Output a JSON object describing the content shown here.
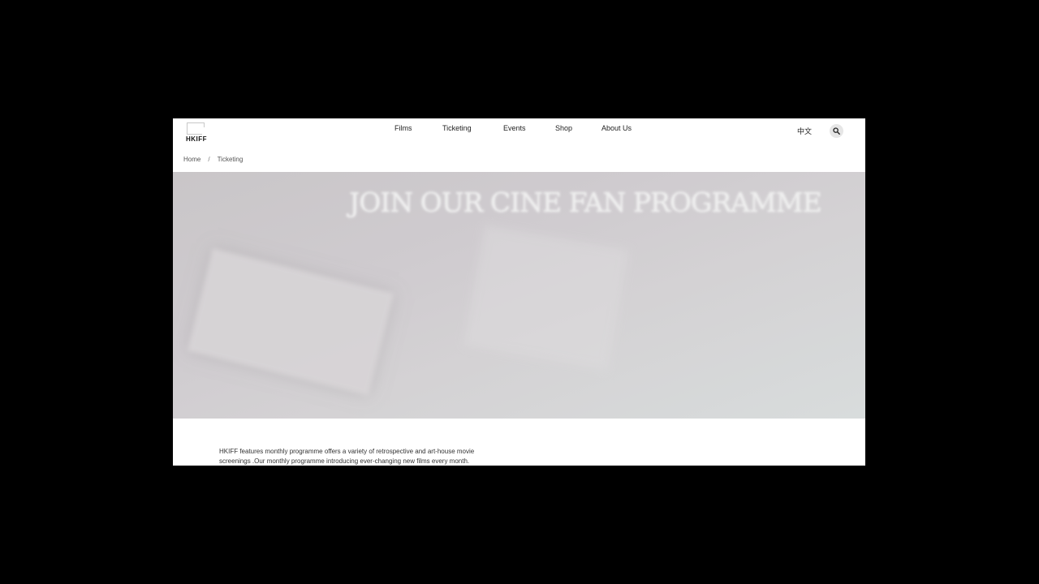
{
  "header": {
    "logo_text": "HKIFF",
    "nav": [
      {
        "label": "Films"
      },
      {
        "label": "Ticketing"
      },
      {
        "label": "Events"
      },
      {
        "label": "Shop"
      },
      {
        "label": "About Us"
      }
    ],
    "language_toggle": "中文",
    "search_icon": "search-icon"
  },
  "breadcrumb": {
    "home": "Home",
    "separator": "/",
    "current": "Ticketing"
  },
  "hero": {
    "title": "JOIN OUR CINE FAN PROGRAMME"
  },
  "content": {
    "line1": "HKIFF features monthly programme offers  a variety of retrospective and art-house movie",
    "line2": "screenings .Our monthly programme introducing ever-changing new films every month."
  },
  "colors": {
    "page_background": "#000000",
    "header_background": "#ffffff",
    "hero_background": "#cfcbcf",
    "search_button": "#e6e6e6"
  }
}
